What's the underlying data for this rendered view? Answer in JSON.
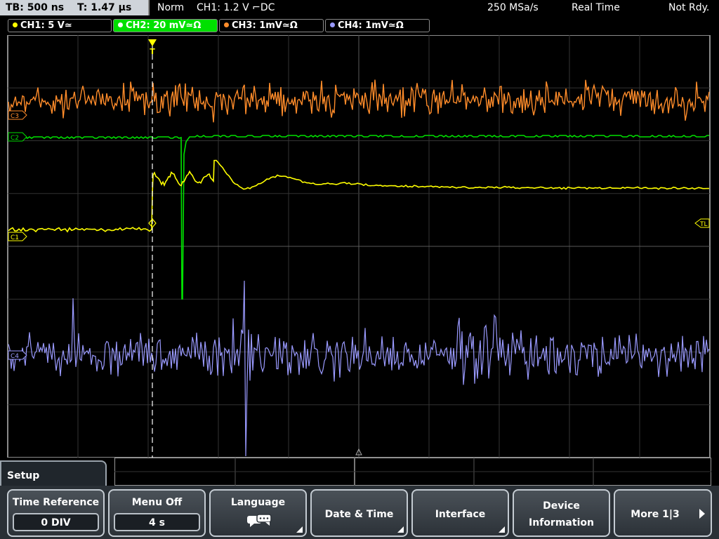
{
  "status": {
    "timebase": "TB: 500 ns",
    "trigger_time": "T: 1.47 µs",
    "mode": "Norm",
    "trigger": "CH1: 1.2 V ⌐DC",
    "sample_rate": "250 MSa/s",
    "acquisition": "Real Time",
    "ready": "Not Rdy."
  },
  "channels": [
    {
      "label": "CH1: 5 V≃",
      "color": "#ffff00",
      "active": false
    },
    {
      "label": "CH2: 20 mV≃Ω",
      "color": "#00e000",
      "active": true
    },
    {
      "label": "CH3: 1mV≃Ω",
      "color": "#ff8c2a",
      "active": false
    },
    {
      "label": "CH4: 1mV≃Ω",
      "color": "#9a9aff",
      "active": false
    }
  ],
  "markers": {
    "c3": "C3",
    "c2": "C2",
    "c1": "C1",
    "c4": "C4",
    "tl": "TL",
    "trigger": "T"
  },
  "menu": {
    "title": "Setup",
    "keys": [
      {
        "label": "Time Reference",
        "value": "0 DIV"
      },
      {
        "label": "Menu Off",
        "value": "4 s"
      },
      {
        "label": "Language",
        "icon": "speech-bubbles-icon"
      },
      {
        "label": "Date & Time"
      },
      {
        "label": "Interface"
      },
      {
        "label1": "Device",
        "label2": "Information"
      },
      {
        "label": "More 1|3"
      }
    ]
  },
  "trace_colors": {
    "ch1": "#ffff00",
    "ch2": "#00e000",
    "ch3": "#ff8c2a",
    "ch4": "#9a9aff",
    "grid": "#3c3c3c"
  }
}
